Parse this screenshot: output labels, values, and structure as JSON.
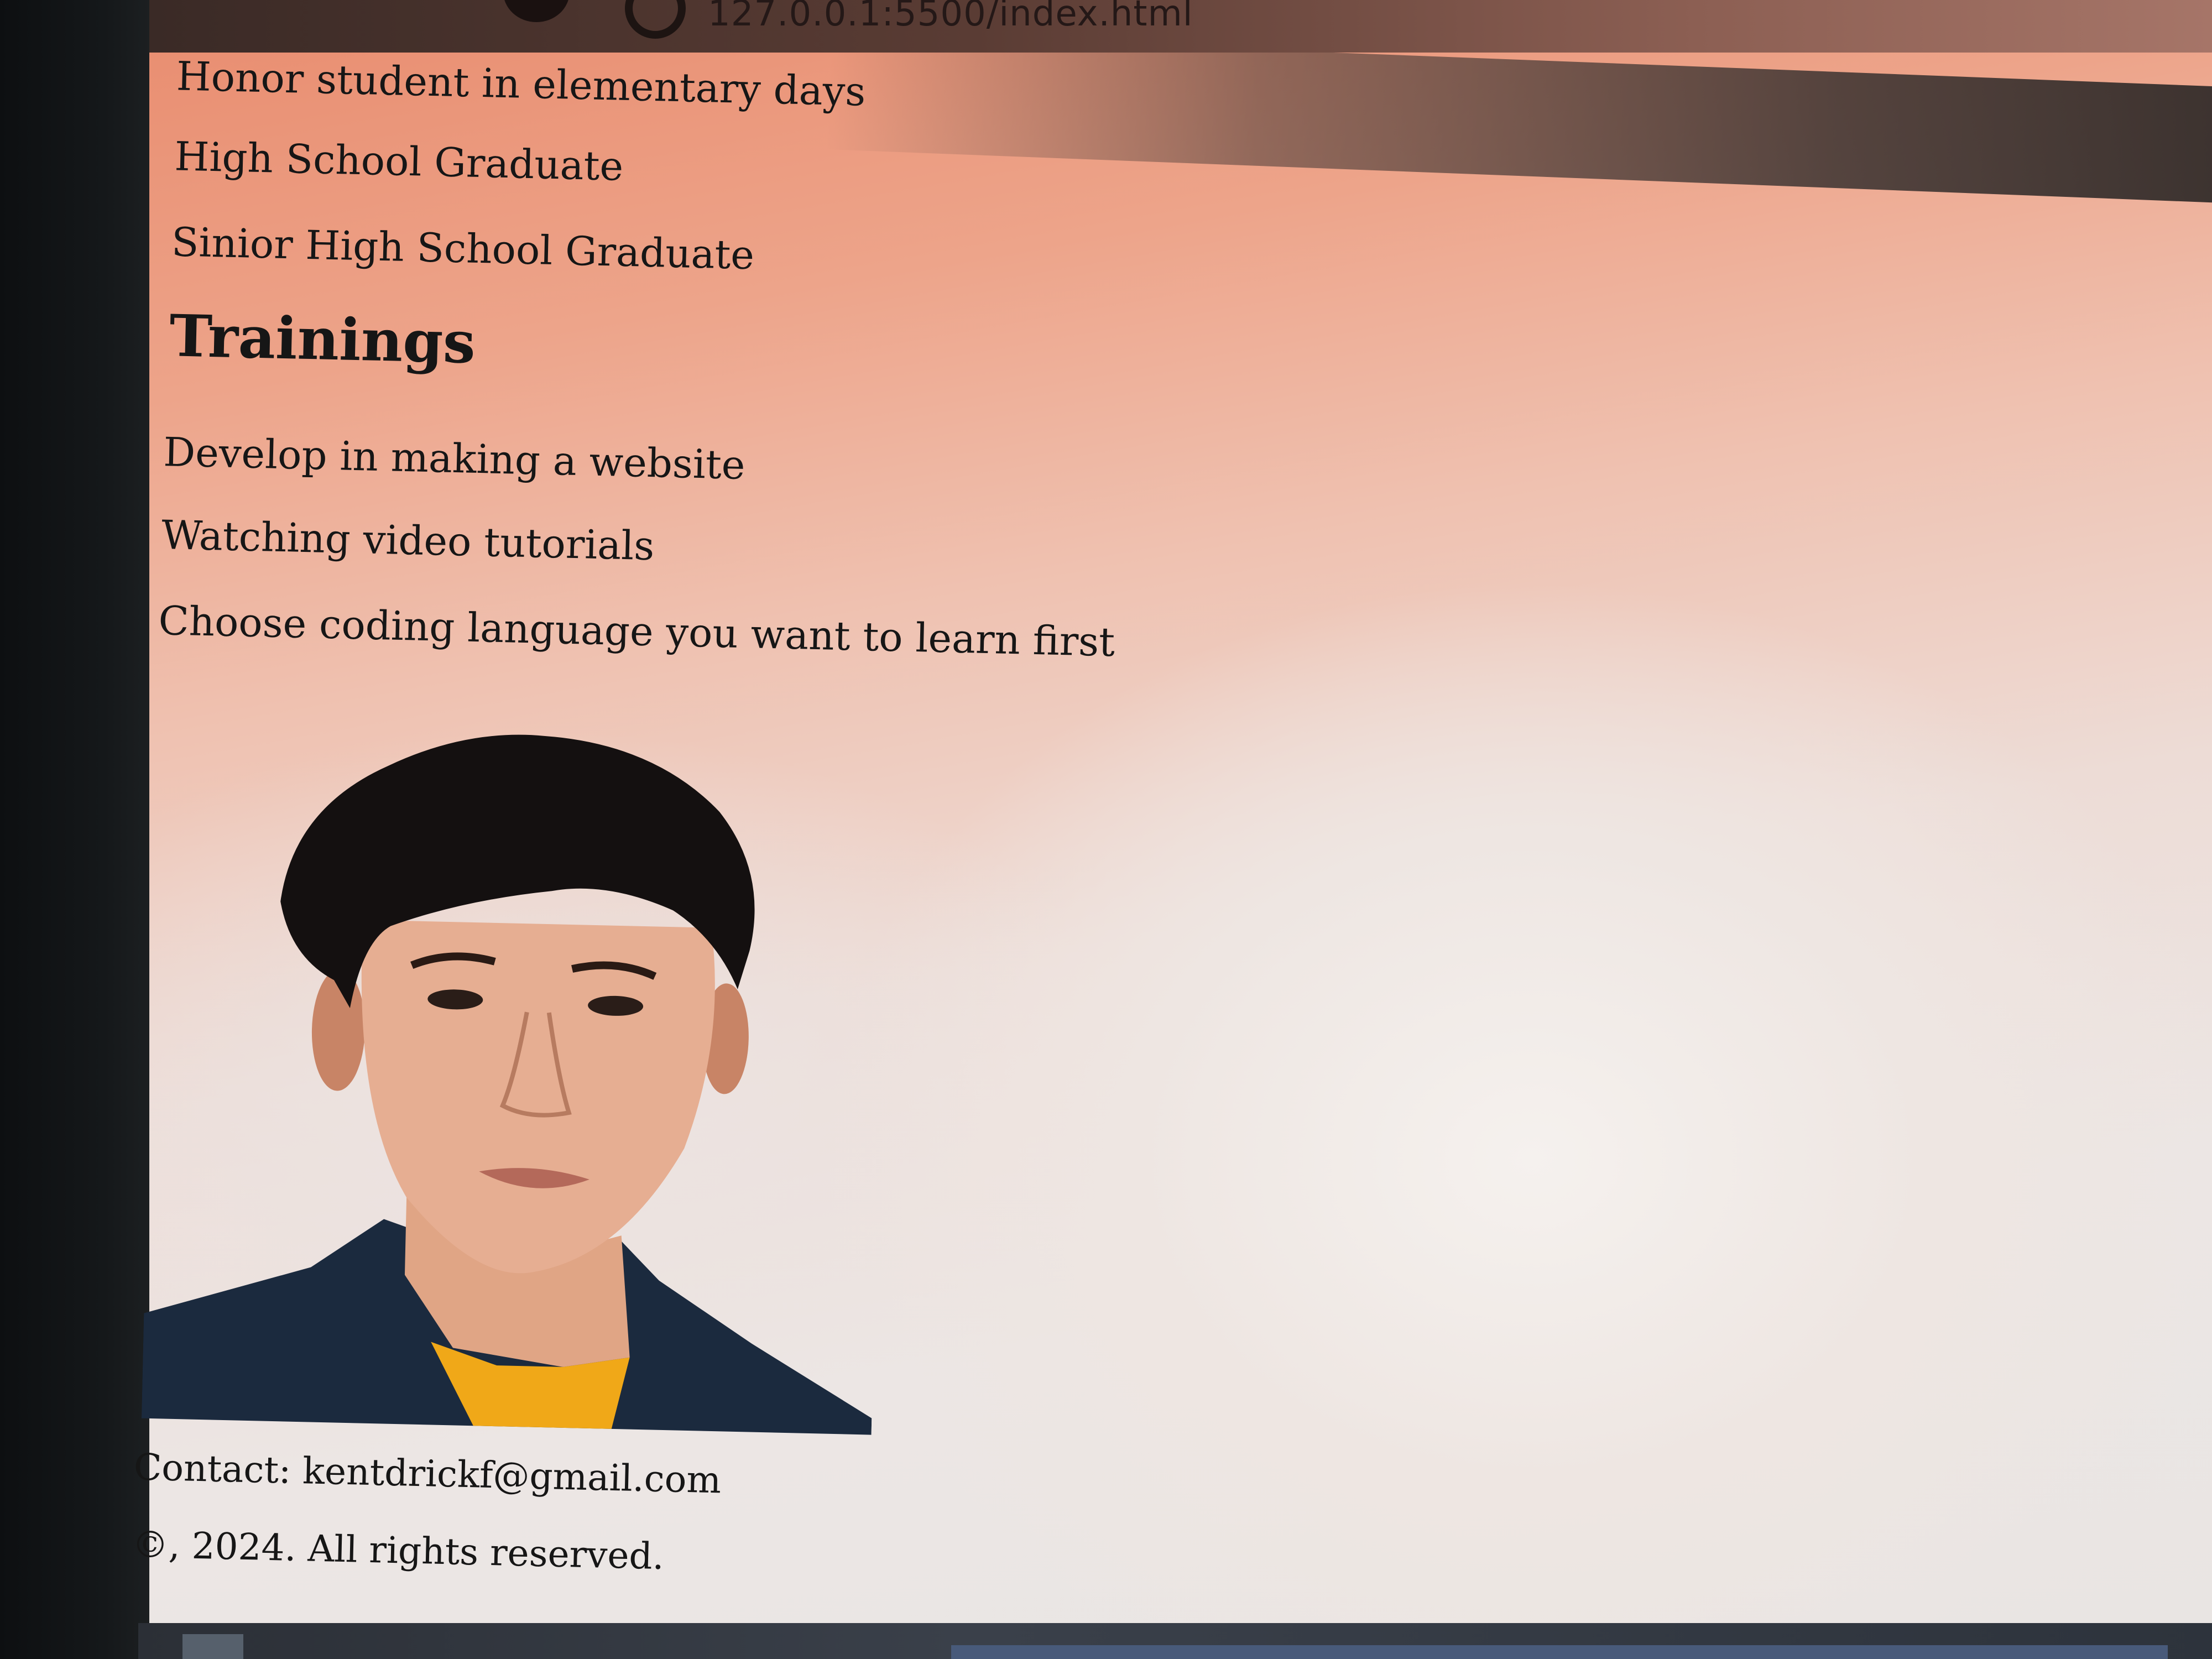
{
  "browser": {
    "url": "127.0.0.1:5500/index.html"
  },
  "education": {
    "items": [
      "Honor student in elementary days",
      "High School Graduate",
      "Sinior High School Graduate"
    ]
  },
  "trainings": {
    "heading": "Trainings",
    "items": [
      "Develop in making a website",
      "Watching video tutorials",
      "Choose coding language you want to learn first"
    ]
  },
  "footer": {
    "contact": "Contact: kentdrickf@gmail.com",
    "copyright": "©, 2024. All rights reserved."
  },
  "colors": {
    "page_bg_top": "#e98f72",
    "page_bg_bottom": "#e9e5e3",
    "text": "#161616",
    "jacket": "#1b2a3e",
    "shirt": "#f0a818"
  },
  "icons": {
    "portrait": "profile-photo"
  }
}
